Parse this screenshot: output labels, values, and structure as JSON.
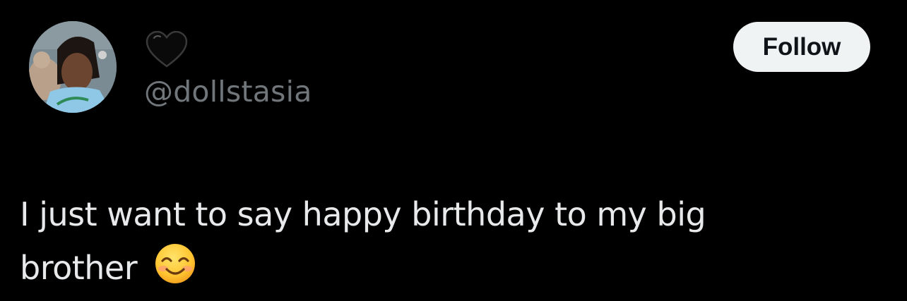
{
  "user": {
    "display_name": "🖤",
    "handle": "@dollstasia",
    "avatar_icon": "profile-photo"
  },
  "actions": {
    "follow_label": "Follow"
  },
  "tweet": {
    "text": "I just want to say happy birthday to my big brother",
    "emoji": "smiling-face-with-smiling-eyes"
  },
  "colors": {
    "background": "#000000",
    "text_primary": "#e7e9ea",
    "text_secondary": "#71767b",
    "follow_bg": "#eff3f4",
    "follow_text": "#0f1419"
  }
}
